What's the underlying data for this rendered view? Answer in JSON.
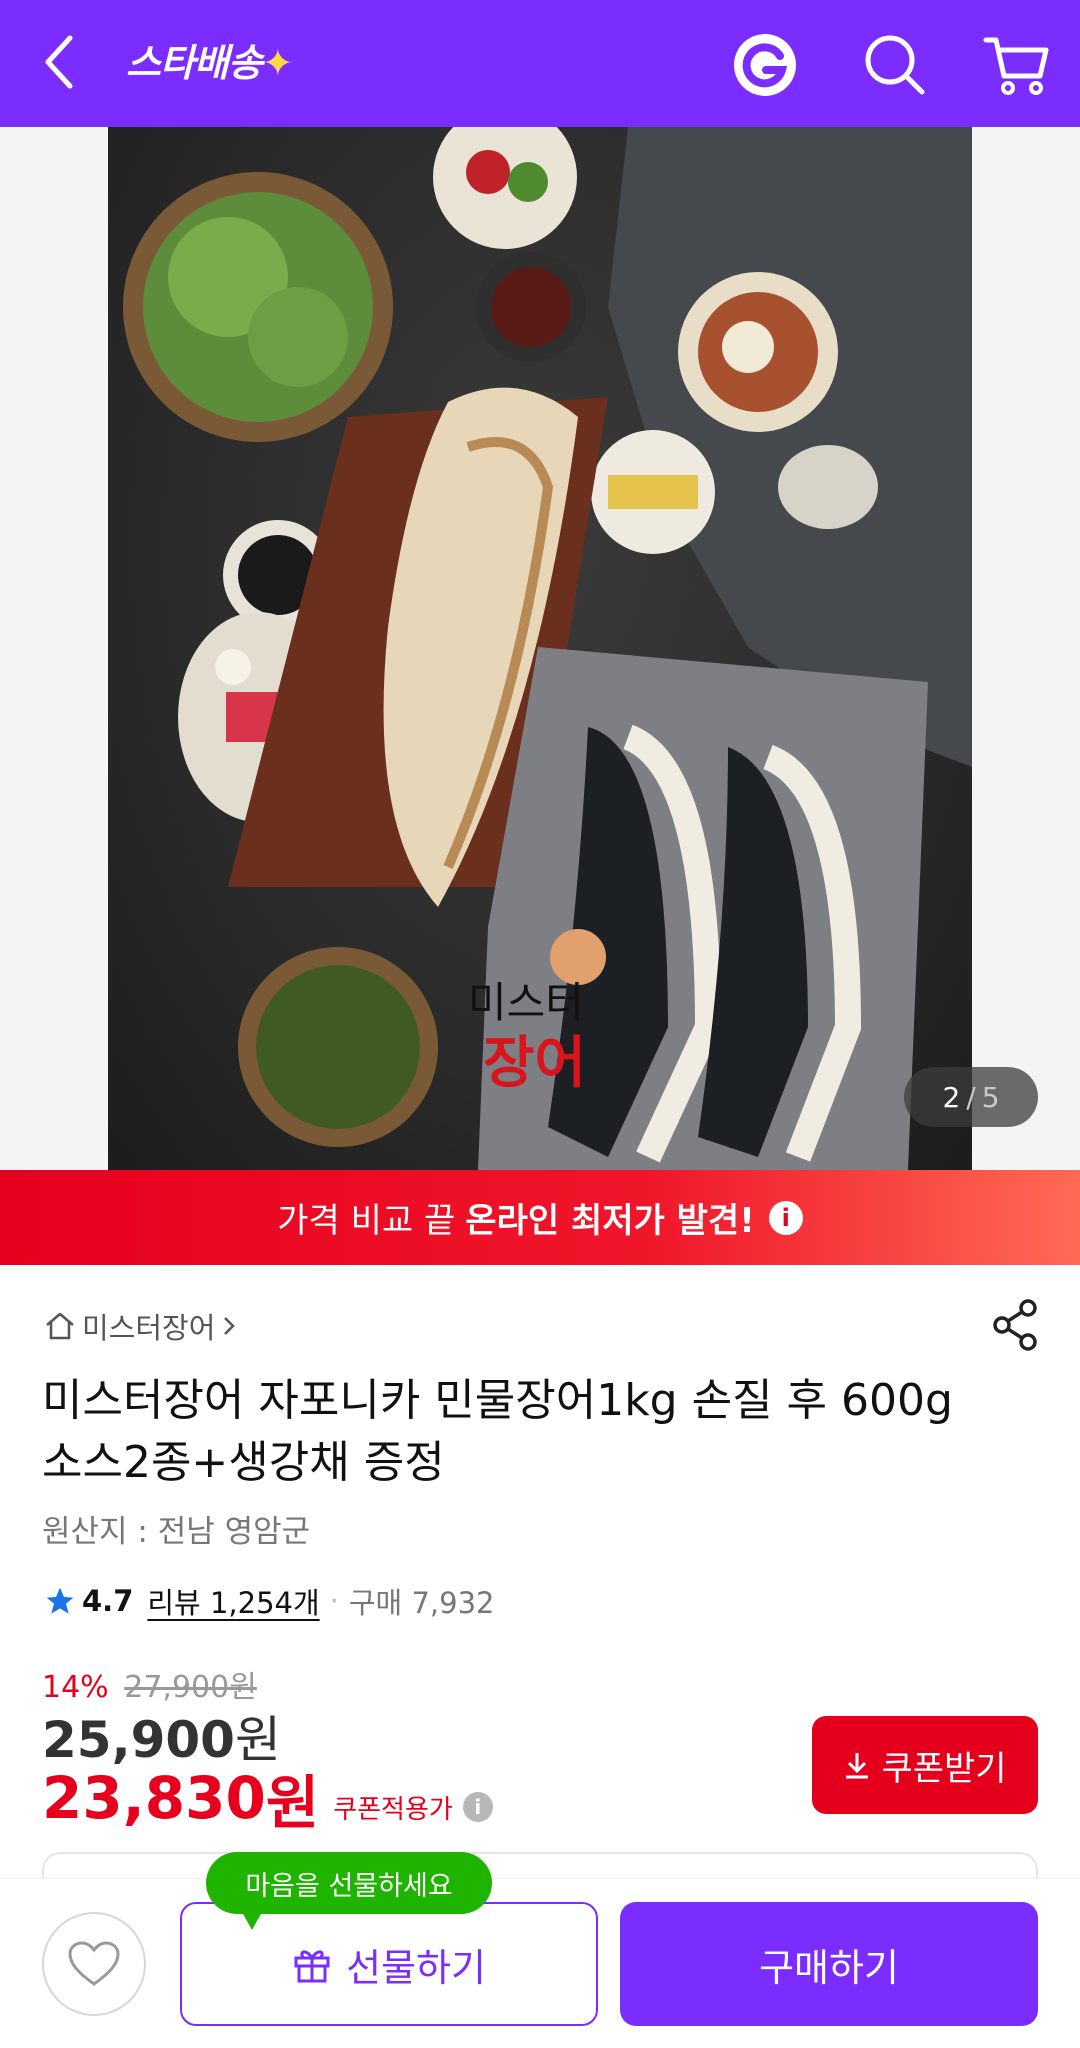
{
  "header": {
    "brand": "스타배송",
    "brand_spark": "✦",
    "icons": [
      "back-icon",
      "g-logo-icon",
      "search-icon",
      "cart-icon"
    ],
    "bg_color": "#7b2cff"
  },
  "gallery": {
    "current": "2",
    "total": "5",
    "separator": "/",
    "image_text_line1": "미스터",
    "image_text_line2": "장어"
  },
  "banner": {
    "prefix": "가격 비교 끝",
    "bold": "온라인 최저가 발견!",
    "info_glyph": "i"
  },
  "product": {
    "store": "미스터장어",
    "title": "미스터장어 자포니카 민물장어1kg 손질 후 600g 소스2종+생강채 증정",
    "origin": "원산지 : 전남 영암군",
    "rating": "4.7",
    "reviews": "리뷰 1,254개",
    "purchases": "구매 7,932"
  },
  "price": {
    "discount_pct": "14%",
    "original": "27,900원",
    "sale_value": "25,900",
    "sale_unit": "원",
    "coupon_value": "23,830",
    "coupon_unit": "원",
    "coupon_label": "쿠폰적용가",
    "info_glyph": "i",
    "coupon_button": "쿠폰받기"
  },
  "actions": {
    "tooltip": "마음을 선물하세요",
    "gift_button": "선물하기",
    "buy_button": "구매하기"
  },
  "colors": {
    "accent": "#7b2cff",
    "red": "#e6001e",
    "green": "#1fb400"
  }
}
